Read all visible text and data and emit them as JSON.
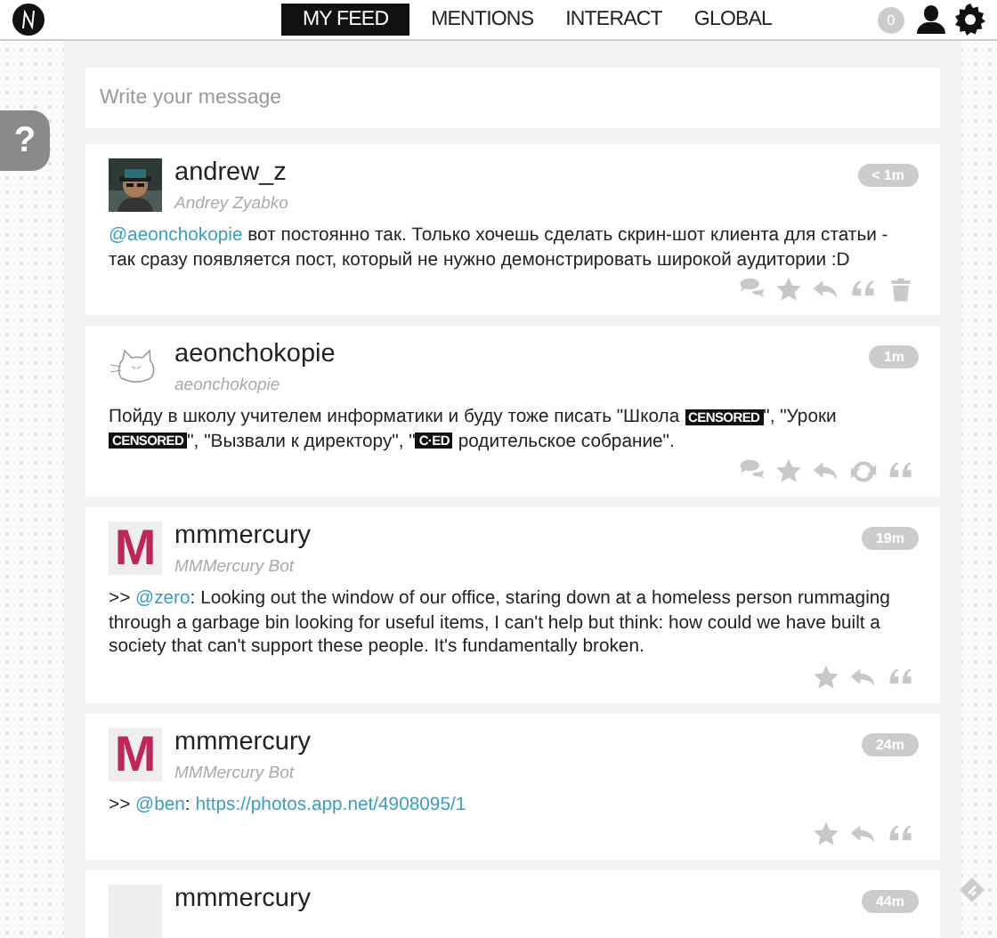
{
  "nav": {
    "tabs": [
      {
        "label": "MY FEED",
        "selected": true
      },
      {
        "label": "MENTIONS",
        "selected": false
      },
      {
        "label": "INTERACT",
        "selected": false
      },
      {
        "label": "GLOBAL",
        "selected": false
      }
    ],
    "unread_count": "0"
  },
  "help_tab": "?",
  "compose": {
    "placeholder": "Write your message"
  },
  "posts": [
    {
      "username": "andrew_z",
      "full_name": "Andrey Zyabko",
      "time": "< 1m",
      "avatar": {
        "kind": "picture"
      },
      "body": [
        {
          "kind": "mention",
          "text": "@aeonchokopie"
        },
        {
          "kind": "text",
          "text": " вот постоянно так. Только хочешь сделать скрин-шот клиента для статьи - так сразу появляется пост, который не нужно демонстрировать широкой аудитории :D"
        }
      ],
      "actions": [
        {
          "kind": "conversation"
        },
        {
          "kind": "star"
        },
        {
          "kind": "reply"
        },
        {
          "kind": "quote"
        },
        {
          "kind": "delete"
        }
      ]
    },
    {
      "username": "aeonchokopie",
      "full_name": "aeonchokopie",
      "time": "1m",
      "avatar": {
        "kind": "drawing"
      },
      "body": [
        {
          "kind": "text",
          "text": "Пойду в школу учителем информатики и буду тоже писать \"Школа "
        },
        {
          "kind": "censored",
          "text": "CENSORED"
        },
        {
          "kind": "text",
          "text": "\", \"Уроки "
        },
        {
          "kind": "censored",
          "text": "CENSORED"
        },
        {
          "kind": "text",
          "text": "\", \"Вызвали к директору\", \""
        },
        {
          "kind": "censored",
          "text": "C·ED"
        },
        {
          "kind": "text",
          "text": " родительское собрание\"."
        }
      ],
      "actions": [
        {
          "kind": "conversation"
        },
        {
          "kind": "star"
        },
        {
          "kind": "reply"
        },
        {
          "kind": "repost"
        },
        {
          "kind": "quote"
        }
      ]
    },
    {
      "username": "mmmercury",
      "full_name": "MMMercury Bot",
      "time": "19m",
      "avatar": {
        "kind": "letter",
        "letter": "M"
      },
      "body": [
        {
          "kind": "text",
          "text": ">> "
        },
        {
          "kind": "mention",
          "text": "@zero"
        },
        {
          "kind": "text",
          "text": ": Looking out the window of our office, staring down at a homeless person rummaging through a garbage bin looking for useful items, I can't help but think: how could we have built a society that can't support these people. It's fundamentally broken."
        }
      ],
      "actions": [
        {
          "kind": "star"
        },
        {
          "kind": "reply"
        },
        {
          "kind": "quote"
        }
      ]
    },
    {
      "username": "mmmercury",
      "full_name": "MMMercury Bot",
      "time": "24m",
      "avatar": {
        "kind": "letter",
        "letter": "M"
      },
      "body": [
        {
          "kind": "text",
          "text": ">> "
        },
        {
          "kind": "mention",
          "text": "@ben"
        },
        {
          "kind": "text",
          "text": ": "
        },
        {
          "kind": "link",
          "text": "https://photos.app.net/4908095/1"
        }
      ],
      "actions": [
        {
          "kind": "star"
        },
        {
          "kind": "reply"
        },
        {
          "kind": "quote"
        }
      ]
    },
    {
      "username": "mmmercury",
      "time": "44m",
      "avatar": {
        "kind": "letter"
      }
    }
  ]
}
